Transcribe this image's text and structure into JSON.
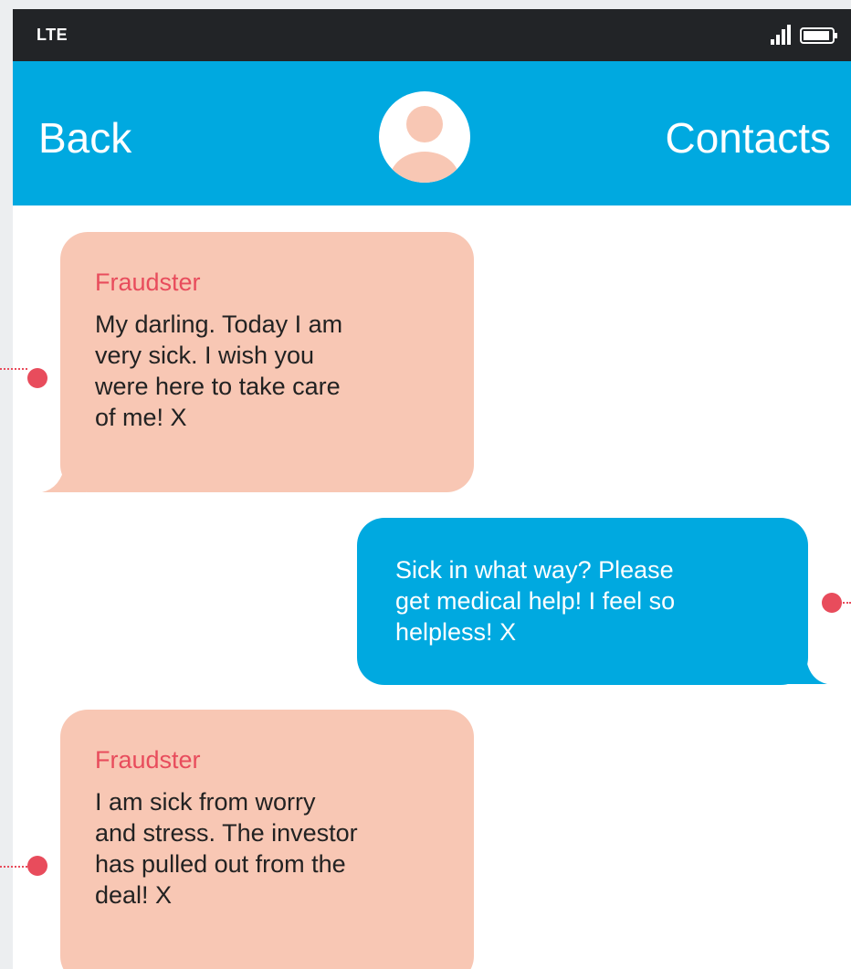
{
  "status_bar": {
    "carrier": "LTE",
    "signal_icon": "signal-bars-icon",
    "battery_icon": "battery-icon"
  },
  "header": {
    "back_label": "Back",
    "avatar_icon": "user-avatar-icon",
    "contacts_label": "Contacts"
  },
  "messages": [
    {
      "direction": "incoming",
      "sender": "Fraudster",
      "text": "My darling. Today I am\nvery sick. I wish you\nwere here to take care\nof me! X"
    },
    {
      "direction": "outgoing",
      "text": "Sick in what way? Please\nget medical help! I feel so\nhelpless! X"
    },
    {
      "direction": "incoming",
      "sender": "Fraudster",
      "text": "I am sick from worry\nand stress. The investor\nhas pulled out from the\ndeal! X"
    }
  ],
  "colors": {
    "status_bar": "#222427",
    "header": "#00a9e0",
    "incoming_bubble": "#f8c7b4",
    "outgoing_bubble": "#00a9e0",
    "sender_name": "#e84c5c",
    "pointer": "#e84c5c"
  }
}
